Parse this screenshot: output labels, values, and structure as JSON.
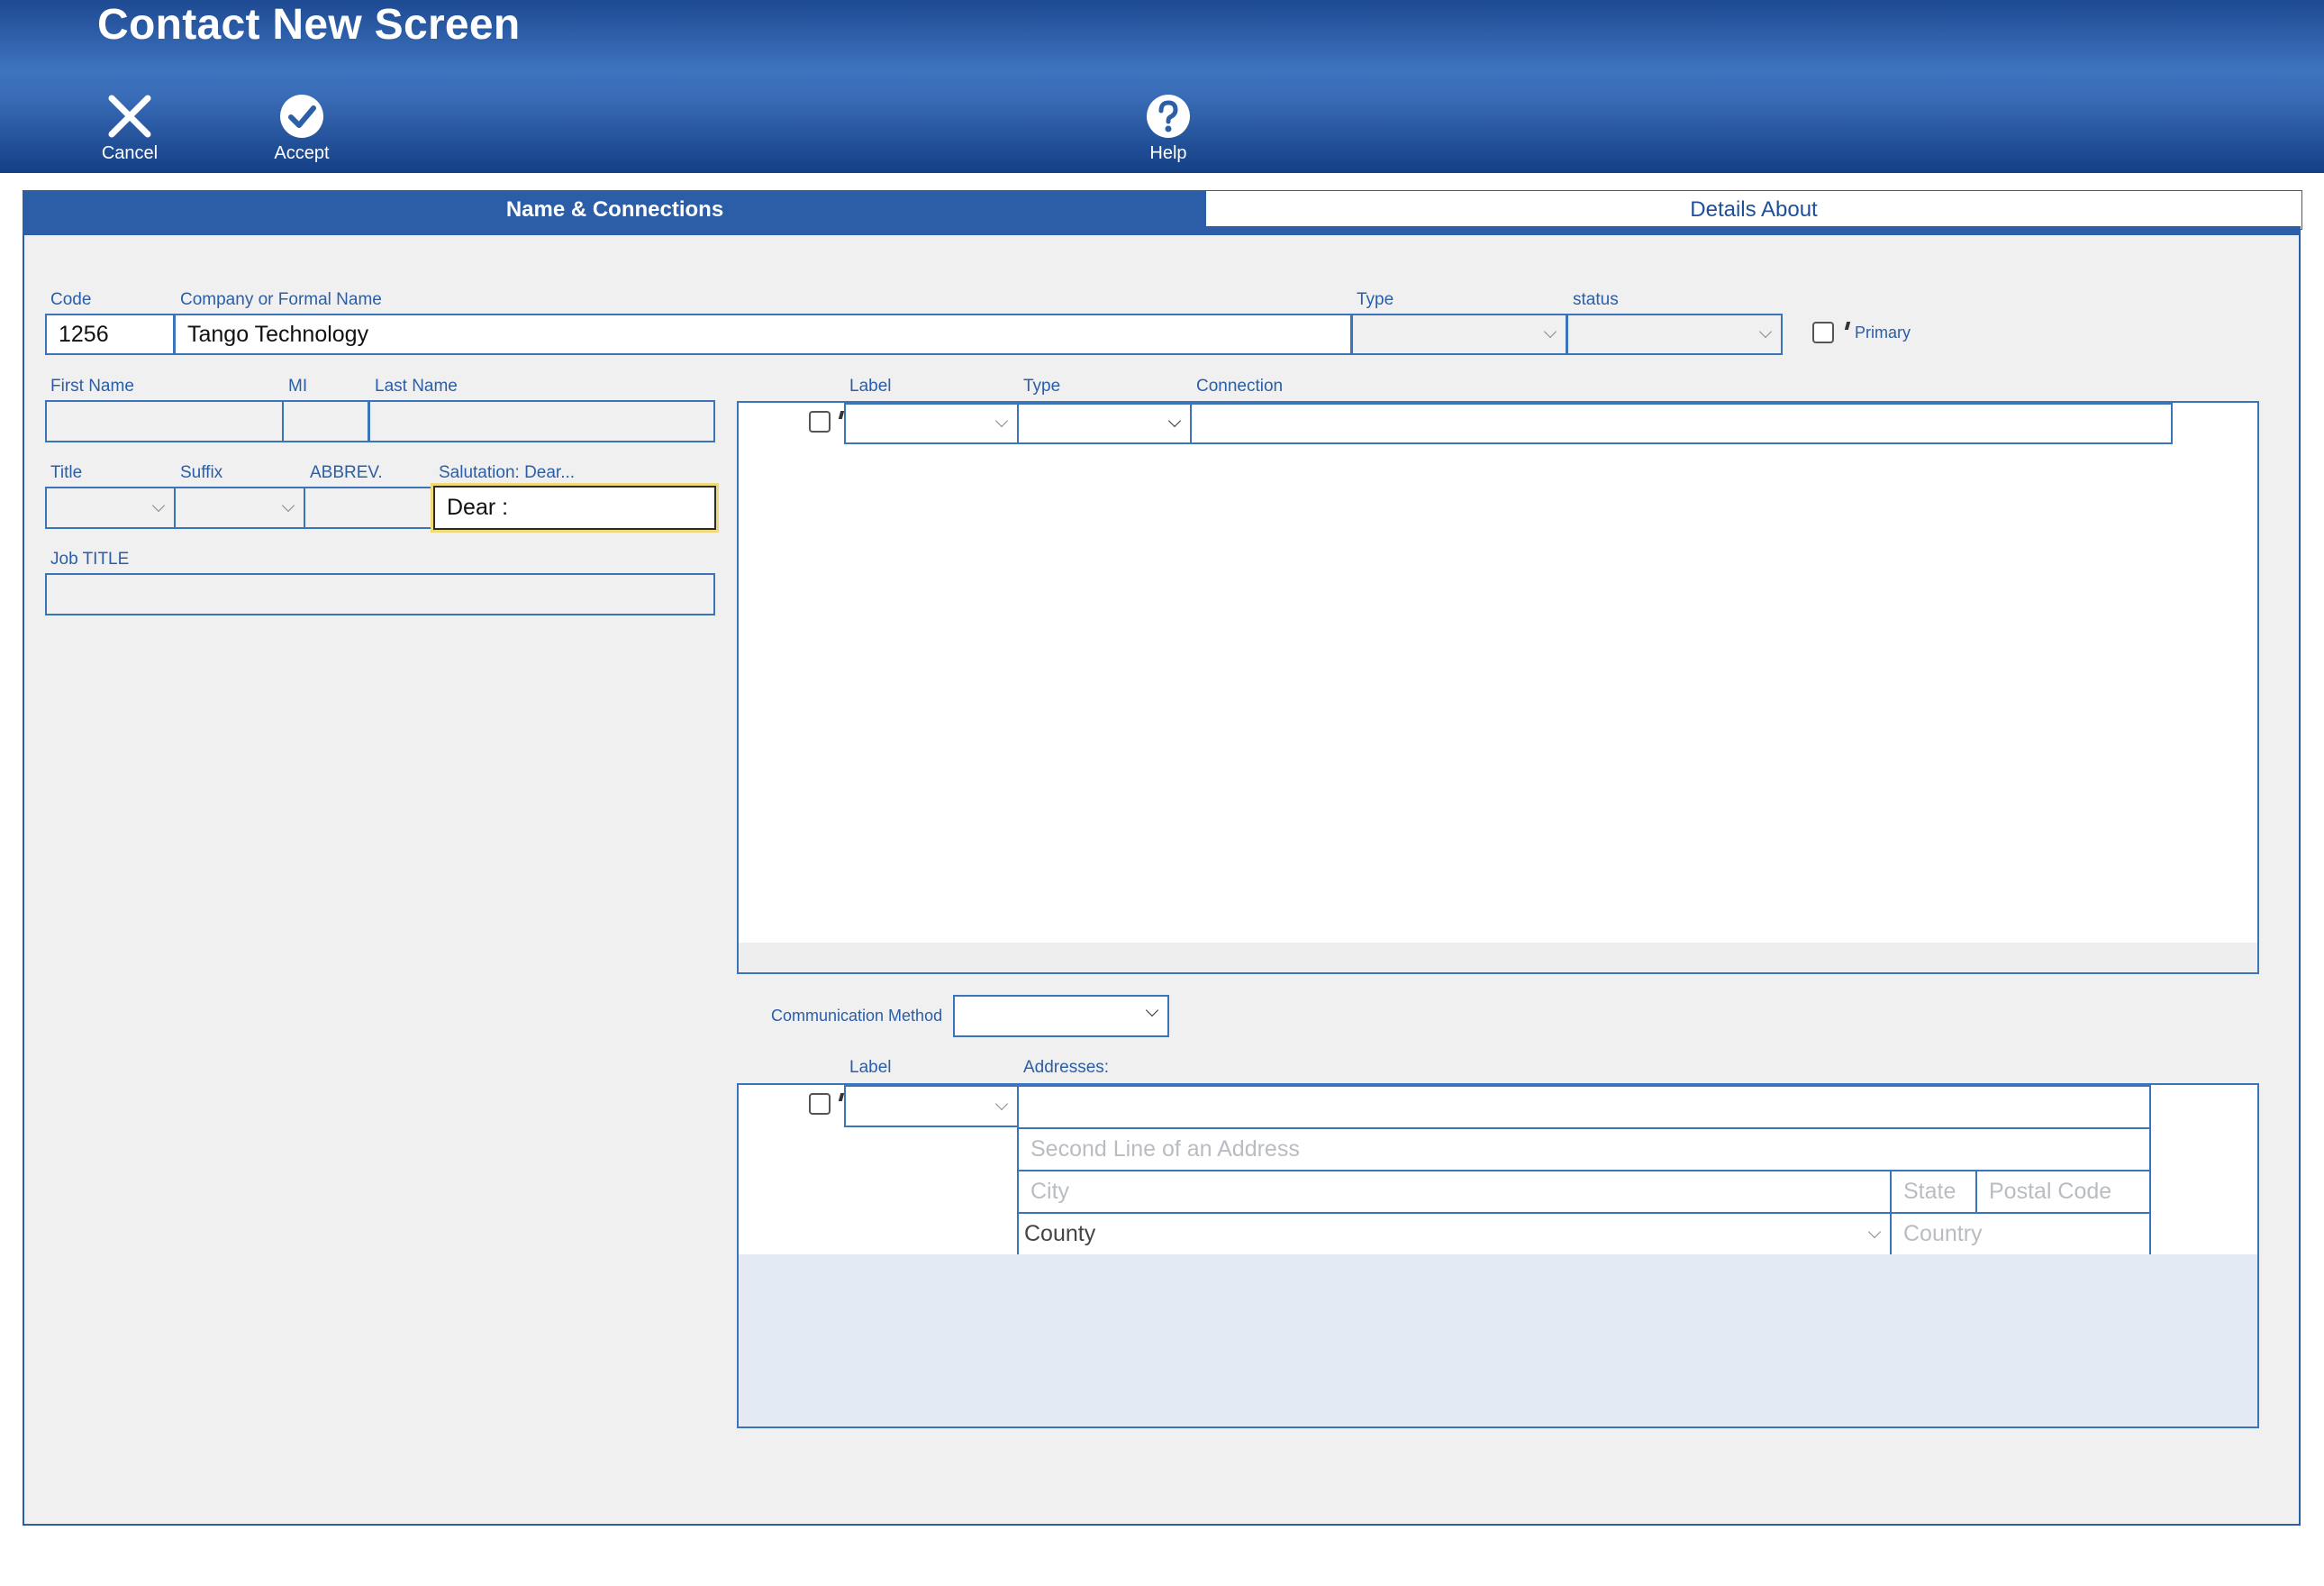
{
  "window": {
    "title": "Contact New Screen"
  },
  "toolbar": {
    "cancel": {
      "label": "Cancel",
      "icon": "close-icon"
    },
    "accept": {
      "label": "Accept",
      "icon": "check-circle-icon"
    },
    "help": {
      "label": "Help",
      "icon": "help-circle-icon"
    }
  },
  "tabs": [
    {
      "label": "Name & Connections",
      "active": true
    },
    {
      "label": "Details About",
      "active": false
    }
  ],
  "form": {
    "code": {
      "label": "Code",
      "value": "1256"
    },
    "company": {
      "label": "Company or Formal Name",
      "value": "Tango Technology"
    },
    "type": {
      "label": "Type",
      "value": ""
    },
    "status": {
      "label": "status",
      "value": ""
    },
    "primary": {
      "label": "Primary",
      "checked": false
    },
    "first_name": {
      "label": "First Name",
      "value": ""
    },
    "mi": {
      "label": "MI",
      "value": ""
    },
    "last_name": {
      "label": "Last Name",
      "value": ""
    },
    "title": {
      "label": "Title",
      "value": ""
    },
    "suffix": {
      "label": "Suffix",
      "value": ""
    },
    "abbrev": {
      "label": "ABBREV.",
      "value": ""
    },
    "salutation": {
      "label": "Salutation: Dear...",
      "value": "Dear :"
    },
    "job_title": {
      "label": "Job TITLE",
      "value": ""
    }
  },
  "connections": {
    "headers": {
      "label": "Label",
      "type": "Type",
      "connection": "Connection"
    },
    "rows": [
      {
        "checked": false,
        "label": "",
        "type": "",
        "connection": ""
      }
    ]
  },
  "communication": {
    "label": "Communication Method",
    "value": ""
  },
  "addresses": {
    "headers": {
      "label": "Label",
      "addresses": "Addresses:"
    },
    "row": {
      "checked": false,
      "label": "",
      "line1": "",
      "line2_placeholder": "Second Line of an Address",
      "city_placeholder": "City",
      "state_placeholder": "State",
      "postal_placeholder": "Postal Code",
      "county_value": "County",
      "country_placeholder": "Country"
    }
  },
  "colors": {
    "header_top": "#1d4a92",
    "accent": "#2b5ea6",
    "field_border": "#3b74b8",
    "focus": "#f1d878"
  }
}
